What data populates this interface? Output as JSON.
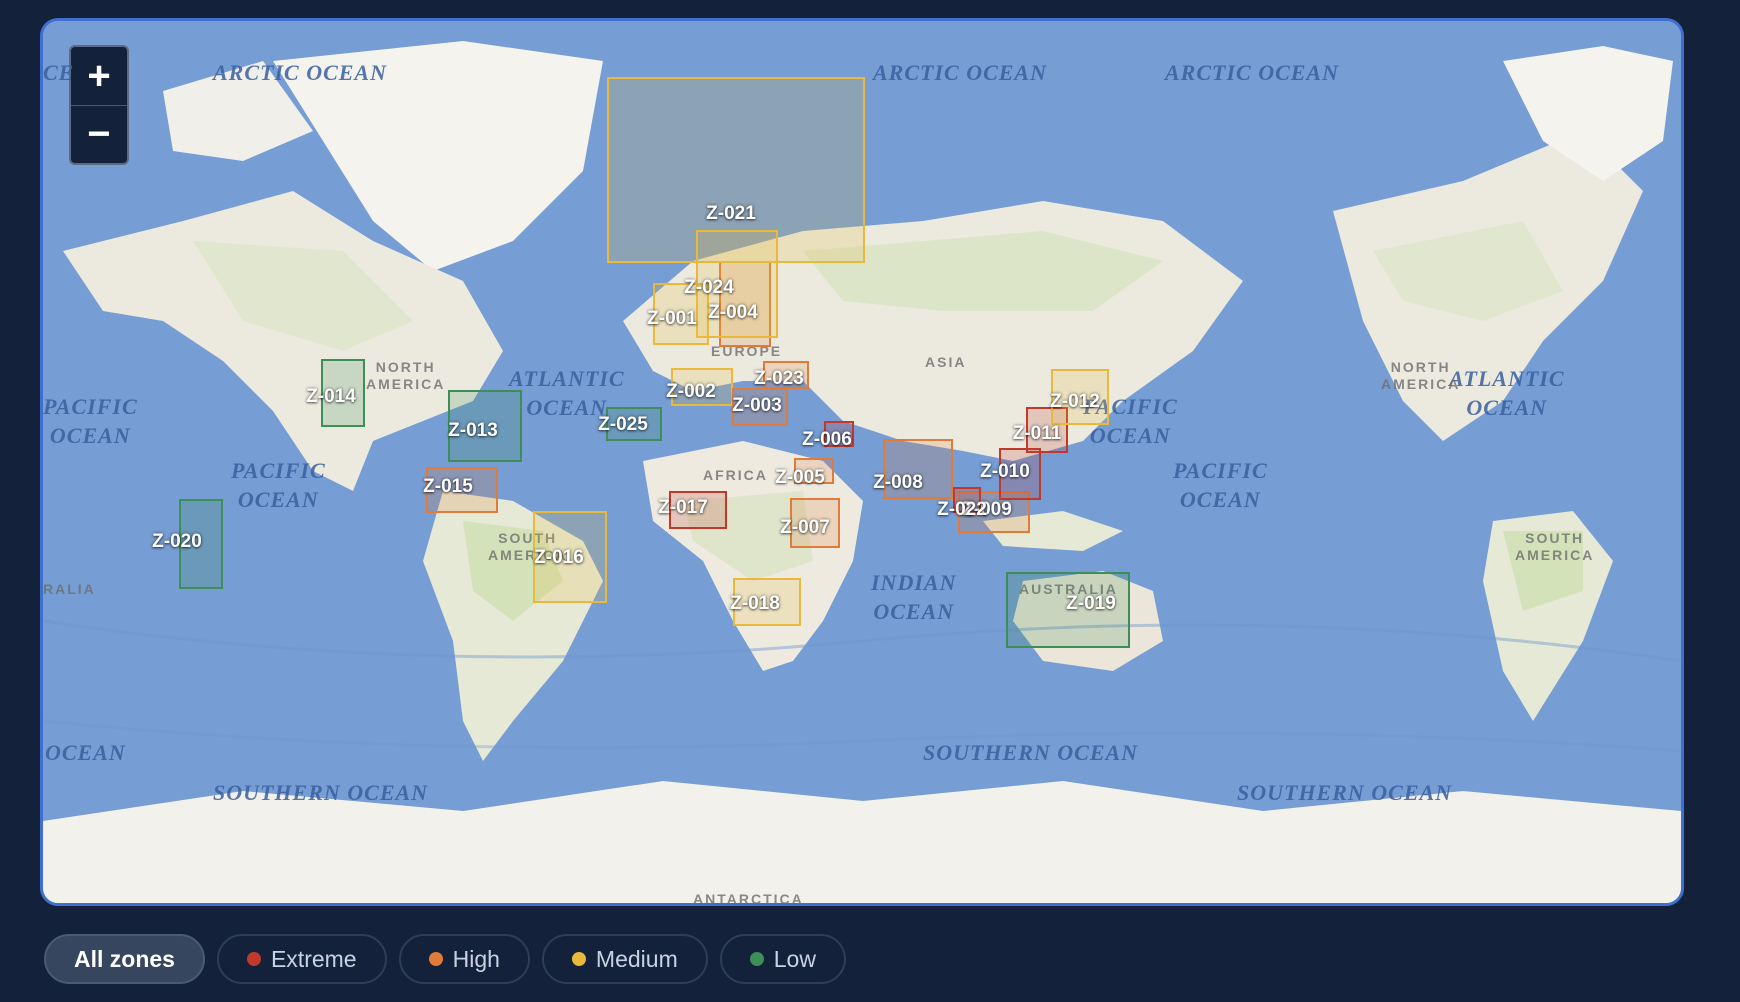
{
  "map": {
    "zoom_in_label": "+",
    "zoom_out_label": "−",
    "ocean_labels": [
      {
        "id": "arctic-1",
        "text": "ARCTIC OCEAN"
      },
      {
        "id": "arctic-2",
        "text": "ARCTIC OCEAN"
      },
      {
        "id": "arctic-3",
        "text": "ARCTIC OCEAN"
      },
      {
        "id": "pacific-w",
        "text": "PACIFIC\nOCEAN"
      },
      {
        "id": "pacific-1",
        "text": "PACIFIC\nOCEAN"
      },
      {
        "id": "atlantic-1",
        "text": "ATLANTIC\nOCEAN"
      },
      {
        "id": "pacific-2",
        "text": "PACIFIC\nOCEAN"
      },
      {
        "id": "pacific-3",
        "text": "PACIFIC\nOCEAN"
      },
      {
        "id": "atlantic-2",
        "text": "ATLANTIC\nOCEAN"
      },
      {
        "id": "indian",
        "text": "INDIAN\nOCEAN"
      },
      {
        "id": "ocean-w",
        "text": "OCEAN"
      },
      {
        "id": "southern-1",
        "text": "SOUTHERN OCEAN"
      },
      {
        "id": "southern-2",
        "text": "SOUTHERN OCEAN"
      },
      {
        "id": "southern-3",
        "text": "SOUTHERN OCEAN"
      },
      {
        "id": "arctic-edge",
        "text": "CE"
      }
    ],
    "land_labels": [
      {
        "id": "north-america-1",
        "text": "NORTH\nAMERICA"
      },
      {
        "id": "south-america-1",
        "text": "SOUTH\nAMERICA"
      },
      {
        "id": "europe",
        "text": "EUROPE"
      },
      {
        "id": "africa",
        "text": "AFRICA"
      },
      {
        "id": "asia",
        "text": "ASIA"
      },
      {
        "id": "australia",
        "text": "AUSTRALIA"
      },
      {
        "id": "north-america-2",
        "text": "NORTH\nAMERICA"
      },
      {
        "id": "south-america-2",
        "text": "SOUTH\nAMERICA"
      },
      {
        "id": "antarctica",
        "text": "ANTARCTICA"
      },
      {
        "id": "ralia",
        "text": "RALIA"
      }
    ]
  },
  "risk_colors": {
    "extreme": "#c0392b",
    "high": "#e07b39",
    "medium": "#e8b93a",
    "low": "#3e8e57"
  },
  "zones": [
    {
      "id": "Z-001",
      "risk": "medium"
    },
    {
      "id": "Z-002",
      "risk": "medium"
    },
    {
      "id": "Z-003",
      "risk": "high"
    },
    {
      "id": "Z-004",
      "risk": "high"
    },
    {
      "id": "Z-005",
      "risk": "high"
    },
    {
      "id": "Z-006",
      "risk": "extreme"
    },
    {
      "id": "Z-007",
      "risk": "high"
    },
    {
      "id": "Z-008",
      "risk": "high"
    },
    {
      "id": "Z-009",
      "risk": "high"
    },
    {
      "id": "Z-010",
      "risk": "extreme"
    },
    {
      "id": "Z-011",
      "risk": "extreme"
    },
    {
      "id": "Z-012",
      "risk": "medium"
    },
    {
      "id": "Z-013",
      "risk": "low"
    },
    {
      "id": "Z-014",
      "risk": "low"
    },
    {
      "id": "Z-015",
      "risk": "high"
    },
    {
      "id": "Z-016",
      "risk": "medium"
    },
    {
      "id": "Z-017",
      "risk": "extreme"
    },
    {
      "id": "Z-018",
      "risk": "medium"
    },
    {
      "id": "Z-019",
      "risk": "low"
    },
    {
      "id": "Z-020",
      "risk": "low"
    },
    {
      "id": "Z-021",
      "risk": "medium"
    },
    {
      "id": "Z-022",
      "risk": "extreme"
    },
    {
      "id": "Z-023",
      "risk": "high"
    },
    {
      "id": "Z-024",
      "risk": "medium"
    },
    {
      "id": "Z-025",
      "risk": "low"
    }
  ],
  "filters": [
    {
      "label": "All zones",
      "active": true
    },
    {
      "label": "Extreme",
      "color": "#c0392b"
    },
    {
      "label": "High",
      "color": "#e07b39"
    },
    {
      "label": "Medium",
      "color": "#e8b93a"
    },
    {
      "label": "Low",
      "color": "#3e8e57"
    }
  ]
}
